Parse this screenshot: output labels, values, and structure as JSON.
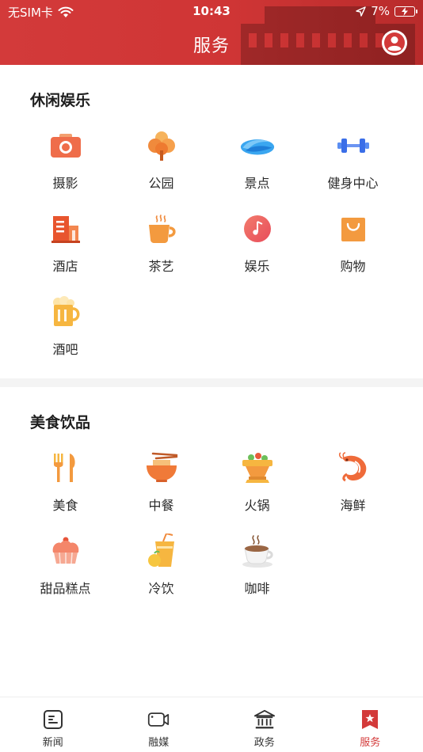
{
  "status_bar": {
    "carrier": "无SIM卡",
    "time": "10:43",
    "battery": "7%"
  },
  "header": {
    "title": "服务"
  },
  "sections": [
    {
      "title": "休闲娱乐",
      "items": [
        {
          "label": "摄影",
          "icon": "camera-icon"
        },
        {
          "label": "公园",
          "icon": "tree-icon"
        },
        {
          "label": "景点",
          "icon": "wave-icon"
        },
        {
          "label": "健身中心",
          "icon": "dumbbell-icon"
        },
        {
          "label": "酒店",
          "icon": "hotel-icon"
        },
        {
          "label": "茶艺",
          "icon": "tea-cup-icon"
        },
        {
          "label": "娱乐",
          "icon": "music-note-icon"
        },
        {
          "label": "购物",
          "icon": "shopping-bag-icon"
        },
        {
          "label": "酒吧",
          "icon": "beer-mug-icon"
        }
      ]
    },
    {
      "title": "美食饮品",
      "items": [
        {
          "label": "美食",
          "icon": "fork-knife-icon"
        },
        {
          "label": "中餐",
          "icon": "noodle-bowl-icon"
        },
        {
          "label": "火锅",
          "icon": "hotpot-icon"
        },
        {
          "label": "海鲜",
          "icon": "shrimp-icon"
        },
        {
          "label": "甜品糕点",
          "icon": "cupcake-icon"
        },
        {
          "label": "冷饮",
          "icon": "cold-drink-icon"
        },
        {
          "label": "咖啡",
          "icon": "coffee-cup-icon"
        }
      ]
    }
  ],
  "tabbar": {
    "tabs": [
      {
        "label": "新闻",
        "icon": "news-icon"
      },
      {
        "label": "融媒",
        "icon": "video-camera-icon"
      },
      {
        "label": "政务",
        "icon": "government-building-icon"
      },
      {
        "label": "服务",
        "icon": "service-bookmark-icon"
      }
    ],
    "active_index": 3
  },
  "colors": {
    "brand": "#d33a3a",
    "icon_orange": "#f08a3c",
    "icon_blue": "#3a6ee8"
  }
}
